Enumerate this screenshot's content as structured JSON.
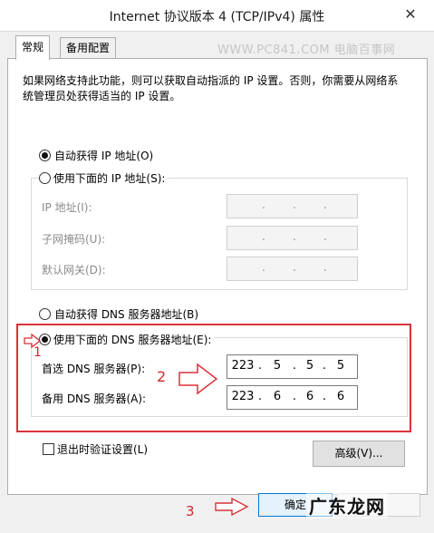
{
  "window": {
    "title": "Internet 协议版本 4 (TCP/IPv4) 属性",
    "close_glyph": "✕"
  },
  "tabs": [
    {
      "label": "常规"
    },
    {
      "label": "备用配置"
    }
  ],
  "watermark": "WWW.PC841.COM 电脑百事网",
  "description": "如果网络支持此功能，则可以获取自动指派的 IP 设置。否则，你需要从网络系统管理员处获得适当的 IP 设置。",
  "ip": {
    "auto_label": "自动获得 IP 地址(O)",
    "manual_label": "使用下面的 IP 地址(S):",
    "fields": [
      {
        "label": "IP 地址(I):"
      },
      {
        "label": "子网掩码(U):"
      },
      {
        "label": "默认网关(D):"
      }
    ]
  },
  "dns": {
    "auto_label": "自动获得 DNS 服务器地址(B)",
    "manual_label": "使用下面的 DNS 服务器地址(E):",
    "preferred": {
      "label": "首选 DNS 服务器(P):",
      "octets": [
        "223",
        "5",
        "5",
        "5"
      ]
    },
    "alternate": {
      "label": "备用 DNS 服务器(A):",
      "octets": [
        "223",
        "6",
        "6",
        "6"
      ]
    }
  },
  "validate_label": "退出时验证设置(L)",
  "advanced_button": "高级(V)...",
  "ok_button": "确定",
  "annotations": {
    "step1": "1",
    "step2": "2",
    "step3": "3"
  },
  "brand_overlay": "广东龙网",
  "colors": {
    "annotation_red": "#d9323a"
  }
}
